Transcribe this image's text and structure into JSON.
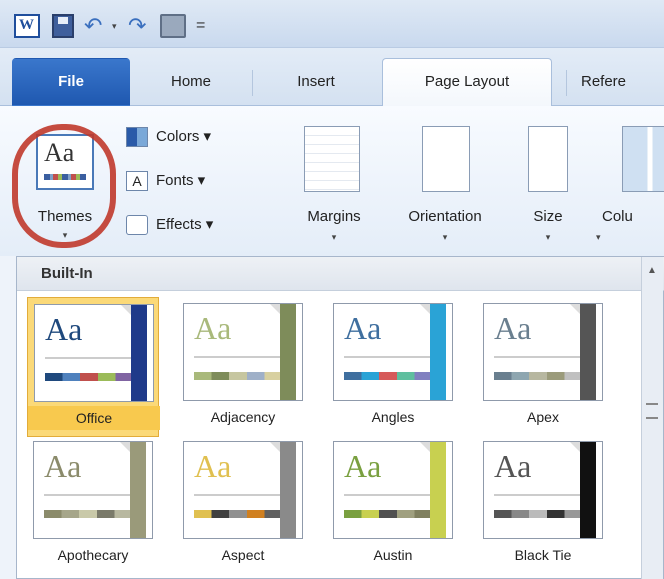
{
  "qat": {
    "word_letter": "W",
    "undo_glyph": "↶",
    "redo_glyph": "↷",
    "dropdown_glyph": "▾",
    "more_glyph": "="
  },
  "tabs": {
    "file": "File",
    "home": "Home",
    "insert": "Insert",
    "page_layout": "Page Layout",
    "references": "Refere"
  },
  "ribbon": {
    "themes_label": "Themes",
    "themes_icon_text": "Aa",
    "colors_label": "Colors ▾",
    "fonts_label": "Fonts ▾",
    "fonts_icon_text": "A",
    "effects_label": "Effects ▾",
    "margins_label": "Margins",
    "orientation_label": "Orientation",
    "size_label": "Size",
    "columns_label": "Colu",
    "arrow": "▾",
    "highlight_color": "#c0392b"
  },
  "gallery": {
    "header": "Built-In",
    "themes": [
      {
        "name": "Office",
        "aa": "Aa",
        "selected": true,
        "accent": "#1f3a8a",
        "palette": [
          "#1f497d",
          "#4f81bd",
          "#c0504d",
          "#9bbb59",
          "#8064a2"
        ]
      },
      {
        "name": "Adjacency",
        "aa": "Aa",
        "selected": false,
        "accent": "#7e8c5a",
        "palette": [
          "#a9b97b",
          "#7e8c5a",
          "#c6c6a0",
          "#9fb0c8",
          "#d8d0a0"
        ]
      },
      {
        "name": "Angles",
        "aa": "Aa",
        "selected": false,
        "accent": "#2aa3d6",
        "palette": [
          "#3f6f9f",
          "#2aa3d6",
          "#d65a5a",
          "#5fbf9f",
          "#8080c0"
        ]
      },
      {
        "name": "Apex",
        "aa": "Aa",
        "selected": false,
        "accent": "#555555",
        "palette": [
          "#6a7f8f",
          "#8ea6b0",
          "#b7b7a0",
          "#9b9b7b",
          "#c0c0c0"
        ]
      },
      {
        "name": "Apothecary",
        "aa": "Aa",
        "selected": false,
        "accent": "#9a9a7a",
        "palette": [
          "#8b8b6b",
          "#a6a68a",
          "#c9c9a9",
          "#7a7a6a",
          "#b8b8a0"
        ]
      },
      {
        "name": "Aspect",
        "aa": "Aa",
        "selected": false,
        "accent": "#8a8a8a",
        "palette": [
          "#e0c050",
          "#404040",
          "#909090",
          "#d08020",
          "#606060"
        ]
      },
      {
        "name": "Austin",
        "aa": "Aa",
        "selected": false,
        "accent": "#c8d050",
        "palette": [
          "#7aa040",
          "#c8d050",
          "#505050",
          "#a0a080",
          "#808060"
        ]
      },
      {
        "name": "Black Tie",
        "aa": "Aa",
        "selected": false,
        "accent": "#111111",
        "palette": [
          "#555555",
          "#888888",
          "#bbbbbb",
          "#333333",
          "#999999"
        ]
      }
    ]
  }
}
